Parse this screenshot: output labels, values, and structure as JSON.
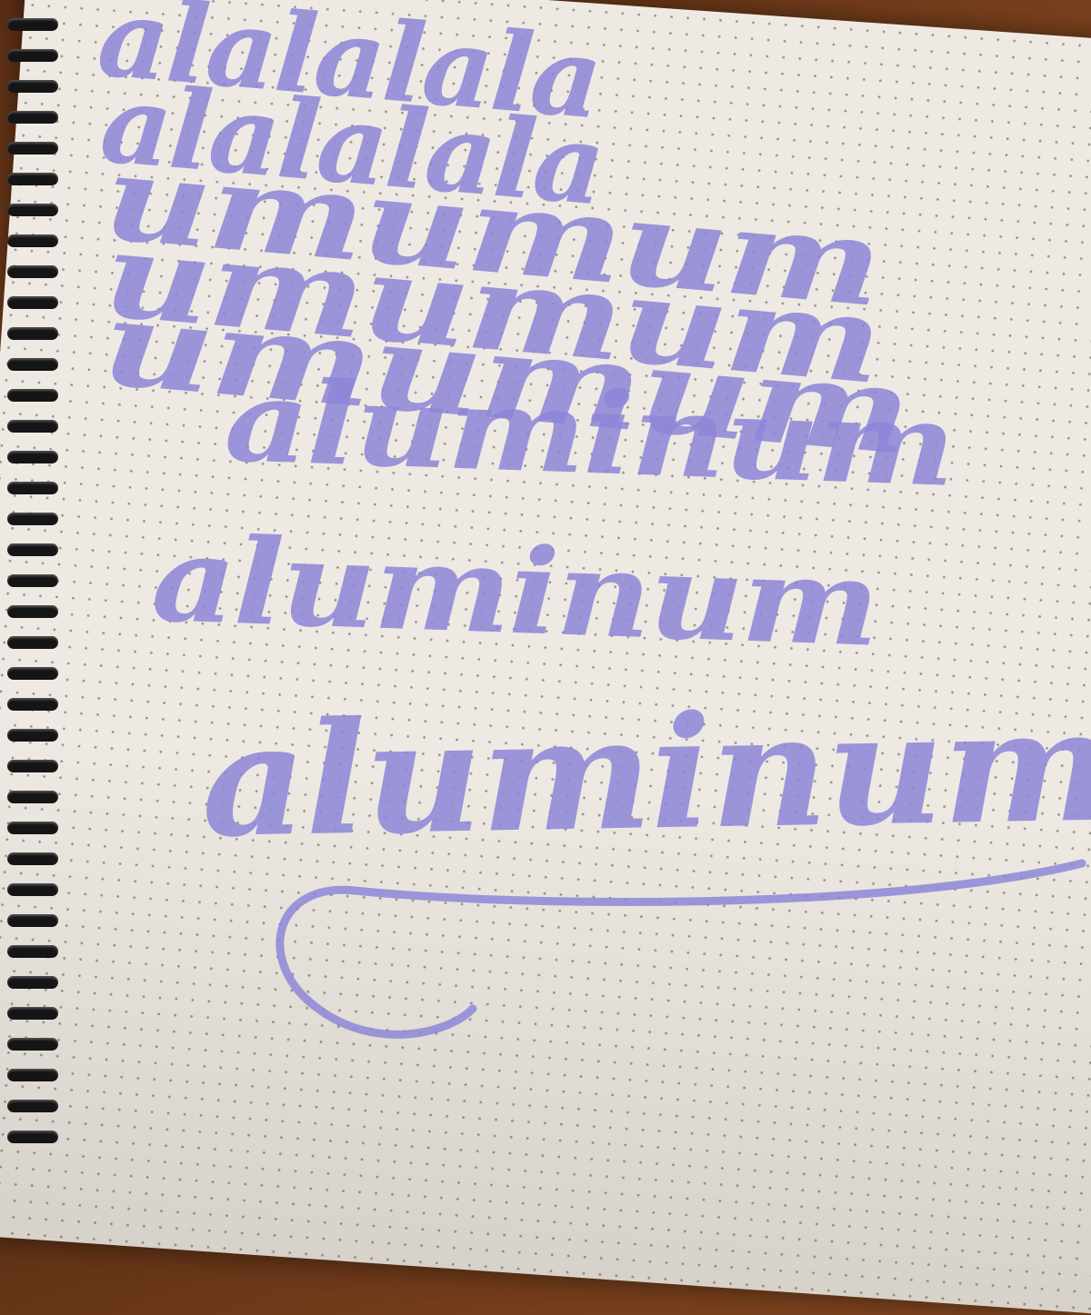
{
  "photo": {
    "ink_color": "#8d86d8",
    "paper": "dot-grid notebook",
    "lines": [
      "alalalala",
      "alalalala",
      "umumum",
      "umumum",
      "umumum",
      "aluminum",
      "aluminum",
      "aluminum"
    ]
  }
}
